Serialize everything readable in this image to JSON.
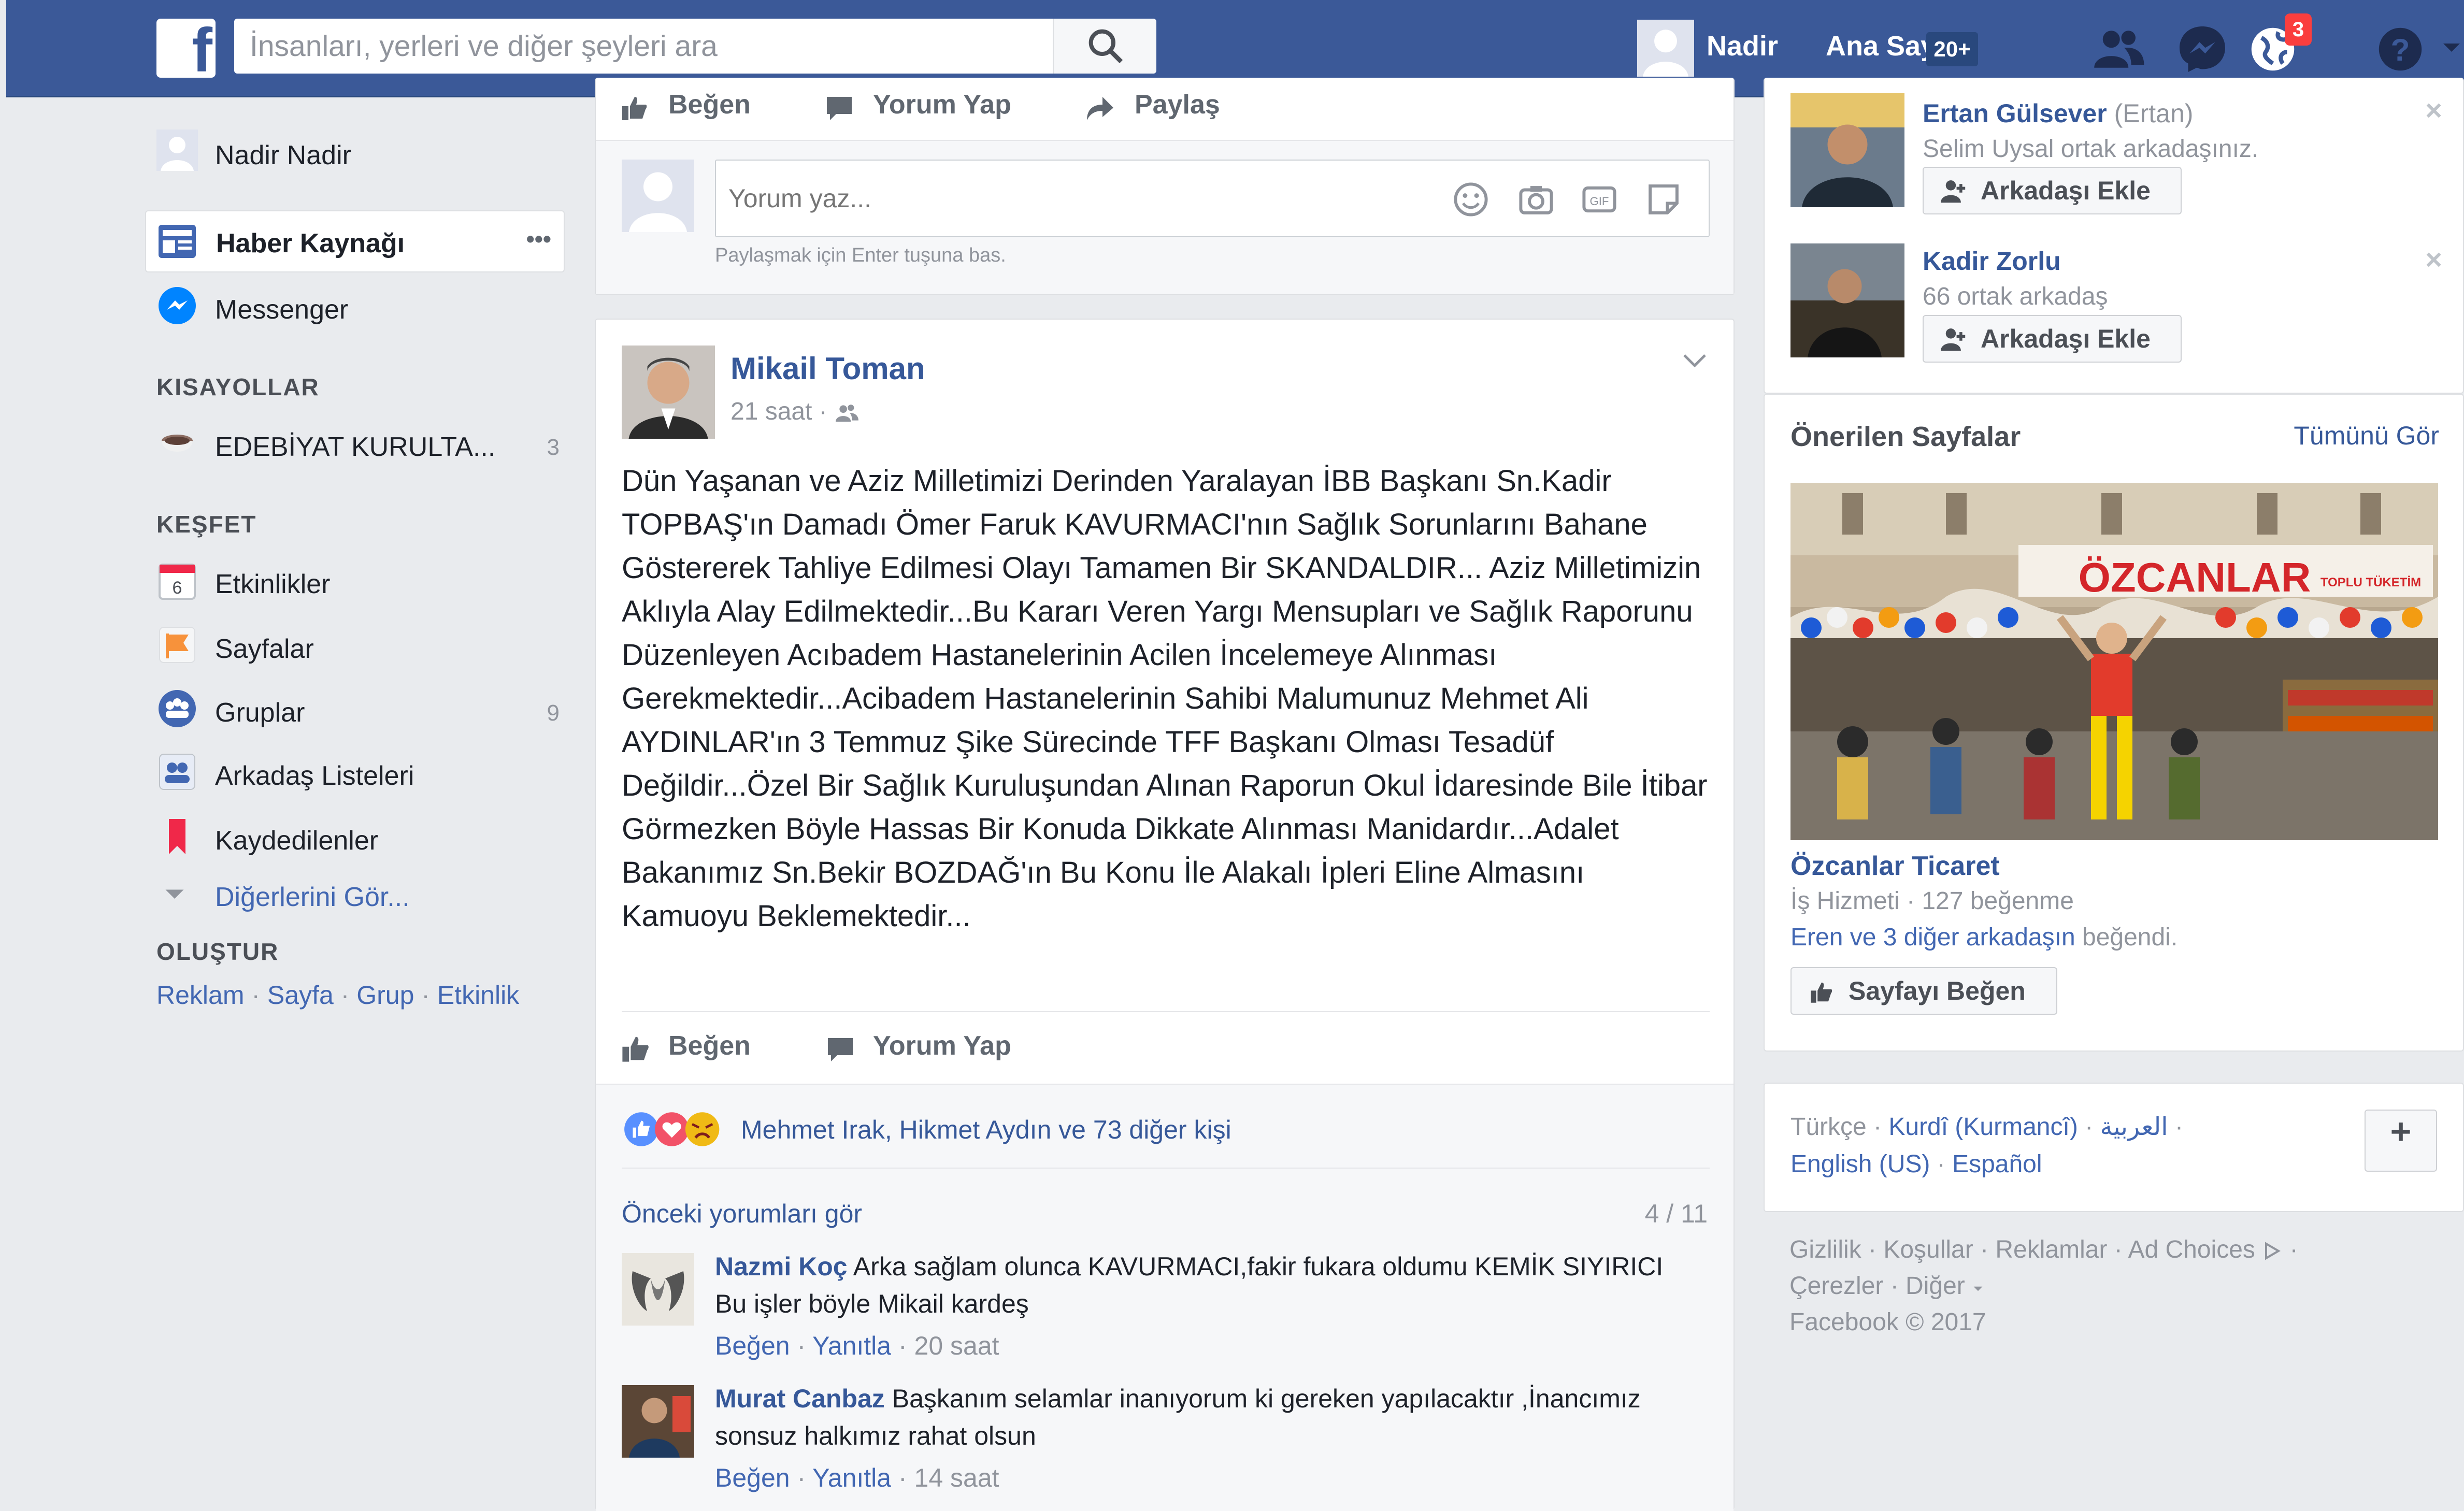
{
  "header": {
    "logo": "f",
    "search_placeholder": "İnsanları, yerleri ve diğer şeyleri ara",
    "user_name": "Nadir",
    "home_label": "Ana Sayfa",
    "home_badge": "20+",
    "notification_count": "3",
    "icons": [
      "search-icon",
      "friends-icon",
      "messenger-icon",
      "globe-icon",
      "help-icon",
      "dropdown-icon"
    ]
  },
  "left_nav": {
    "profile": "Nadir Nadir",
    "news_feed": "Haber Kaynağı",
    "more": "•••",
    "messenger": "Messenger",
    "shortcuts_title": "KISAYOLLAR",
    "shortcut": {
      "label": "EDEBİYAT KURULTA...",
      "count": "3"
    },
    "explore_title": "KEŞFET",
    "explore": [
      {
        "label": "Etkinlikler",
        "icon_text": "6"
      },
      {
        "label": "Sayfalar"
      },
      {
        "label": "Gruplar",
        "count": "9"
      },
      {
        "label": "Arkadaş Listeleri"
      },
      {
        "label": "Kaydedilenler"
      },
      {
        "label": "Diğerlerini Gör..."
      }
    ],
    "create_title": "OLUŞTUR",
    "create_links": [
      "Reklam",
      "Sayfa",
      "Grup",
      "Etkinlik"
    ],
    "separator": " · "
  },
  "prev_post": {
    "actions": [
      "Beğen",
      "Yorum Yap",
      "Paylaş"
    ],
    "comment_placeholder": "Yorum yaz...",
    "hint": "Paylaşmak için Enter tuşuna bas."
  },
  "post": {
    "author": "Mikail Toman",
    "time": "21 saat ·",
    "text": "Dün Yaşanan ve Aziz Milletimizi Derinden Yaralayan İBB Başkanı Sn.Kadir TOPBAŞ'ın Damadı Ömer Faruk KAVURMACI'nın Sağlık Sorunlarını Bahane Göstererek Tahliye Edilmesi Olayı Tamamen Bir SKANDALDIR... Aziz Milletimizin Aklıyla Alay Edilmektedir...Bu Kararı Veren Yargı Mensupları ve Sağlık Raporunu Düzenleyen Acıbadem Hastanelerinin Acilen İncelemeye Alınması Gerekmektedir...Acibadem Hastanelerinin Sahibi Malumunuz Mehmet Ali AYDINLAR'ın 3 Temmuz Şike Sürecinde TFF Başkanı Olması Tesadüf Değildir...Özel Bir Sağlık Kuruluşundan Alınan Raporun Okul İdaresinde Bile İtibar Görmezken Böyle Hassas Bir Konuda Dikkate Alınması Manidardır...Adalet Bakanımız Sn.Bekir BOZDAĞ'ın Bu Konu İle Alakalı İpleri Eline Almasını Kamuoyu Beklemektedir...",
    "actions": [
      "Beğen",
      "Yorum Yap"
    ],
    "reactions_text": "Mehmet Irak, Hikmet Aydın ve 73 diğer kişi",
    "prev_comments": "Önceki yorumları gör",
    "comment_count": "4 / 11",
    "comments": [
      {
        "name": "Nazmi Koç",
        "text": "Arka sağlam olunca KAVURMACI,fakir fukara oldumu KEMİK SIYIRICI Bu işler böyle Mikail kardeş",
        "like": "Beğen",
        "reply": "Yanıtla",
        "time": "20 saat"
      },
      {
        "name": "Murat Canbaz",
        "text": "Başkanım selamlar inanıyorum ki gereken yapılacaktır ,İnancımız sonsuz halkımız rahat olsun",
        "like": "Beğen",
        "reply": "Yanıtla",
        "time": "14 saat"
      }
    ]
  },
  "right": {
    "suggestions": [
      {
        "name": "Ertan Gülsever",
        "alt": "(Ertan)",
        "info": "Selim Uysal ortak arkadaşınız.",
        "button": "Arkadaşı Ekle"
      },
      {
        "name": "Kadir Zorlu",
        "alt": "",
        "info": "66 ortak arkadaş",
        "button": "Arkadaşı Ekle"
      }
    ],
    "close": "×",
    "pages_title": "Önerilen Sayfalar",
    "see_all": "Tümünü Gör",
    "page_name": "Özcanlar Ticaret",
    "page_image_text": "ÖZCANLAR",
    "page_image_sub": "TOPLU TÜKETİM",
    "page_info": "İş Hizmeti · 127 beğenme",
    "page_friends_link": "Eren ve 3 diğer arkadaşın",
    "page_friends_rest": " beğendi.",
    "page_button": "Sayfayı Beğen",
    "langs_line1": [
      "Türkçe",
      "Kurdî (Kurmancî)",
      "العربية"
    ],
    "langs_line2": [
      "English (US)",
      "Español"
    ],
    "plus": "+",
    "footer_line1": "Gizlilik · Koşullar · Reklamlar · Ad Choices",
    "footer_line2": "Çerezler · Diğer",
    "footer_line3": "Facebook © 2017"
  }
}
